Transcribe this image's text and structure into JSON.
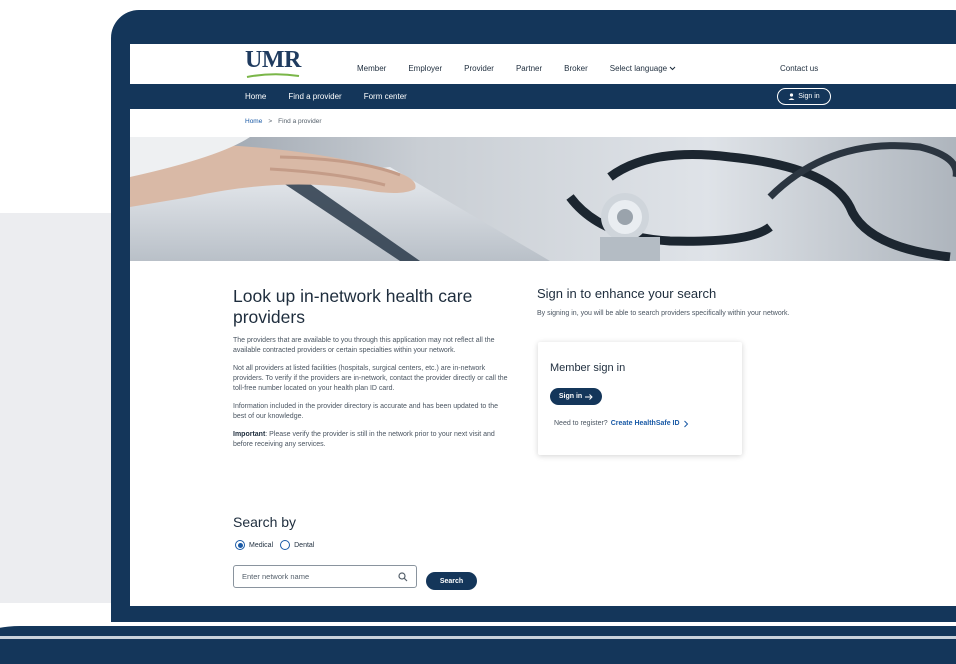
{
  "header": {
    "logo": "UMR",
    "nav": [
      "Member",
      "Employer",
      "Provider",
      "Partner",
      "Broker"
    ],
    "language": "Select language",
    "contact": "Contact us"
  },
  "navbar": {
    "links": [
      "Home",
      "Find a provider",
      "Form center"
    ],
    "signin": "Sign in"
  },
  "breadcrumb": {
    "home": "Home",
    "separator": ">",
    "current": "Find a provider"
  },
  "main": {
    "title": "Look up in-network health care providers",
    "paragraphs": [
      "The providers that are available to you through this application may not reflect all the available contracted providers or certain specialties within your network.",
      "Not all providers at listed facilities (hospitals, surgical centers, etc.) are in-network providers. To verify if the providers are in-network, contact the provider directly or call the toll-free number located on your health plan ID card.",
      "Information included in the provider directory is accurate and has been updated to the best of our knowledge."
    ],
    "important_label": "Important",
    "important_text": ": Please verify the provider is still in the network prior to your next visit and before receiving any services.",
    "search_title": "Search by",
    "radio_medical": "Medical",
    "radio_dental": "Dental",
    "search_placeholder": "Enter network name",
    "search_button": "Search"
  },
  "side": {
    "title": "Sign in to enhance your search",
    "subtitle": "By signing in, you will be able to search providers specifically within your network.",
    "card_title": "Member sign in",
    "card_button": "Sign in",
    "register_text": "Need to register?",
    "register_link": "Create HealthSafe ID"
  },
  "colors": {
    "brand_navy": "#14365a",
    "link_blue": "#1a5aa6"
  }
}
